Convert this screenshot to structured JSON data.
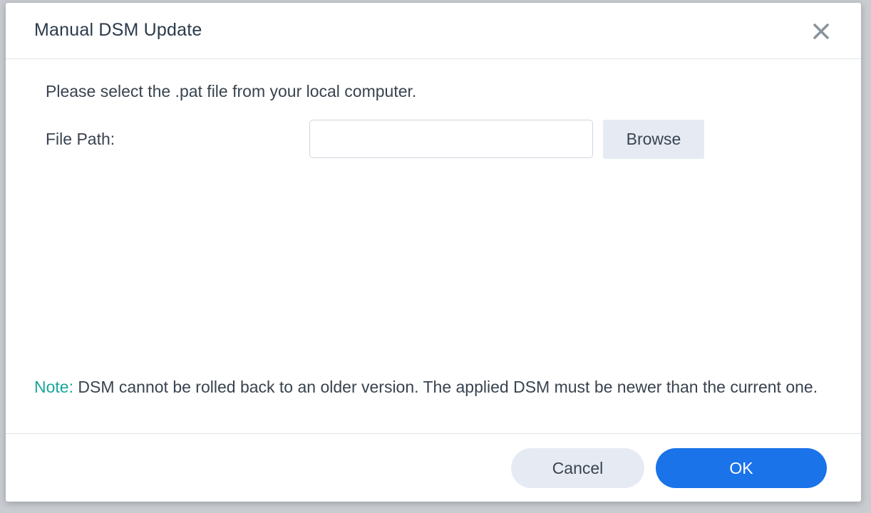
{
  "dialog": {
    "title": "Manual DSM Update",
    "close_icon": "close-icon"
  },
  "form": {
    "instruction": "Please select the .pat file from your local computer.",
    "file_path_label": "File Path:",
    "file_path_value": "",
    "file_path_placeholder": "",
    "browse_label": "Browse"
  },
  "note": {
    "label": "Note:",
    "text": " DSM cannot be rolled back to an older version. The applied DSM must be newer than the current one."
  },
  "footer": {
    "cancel_label": "Cancel",
    "ok_label": "OK"
  },
  "colors": {
    "primary": "#1a73e8",
    "note_label": "#1aa69a",
    "secondary_button": "#e6ebf3",
    "text": "#39434f",
    "close_icon": "#8a939d"
  }
}
